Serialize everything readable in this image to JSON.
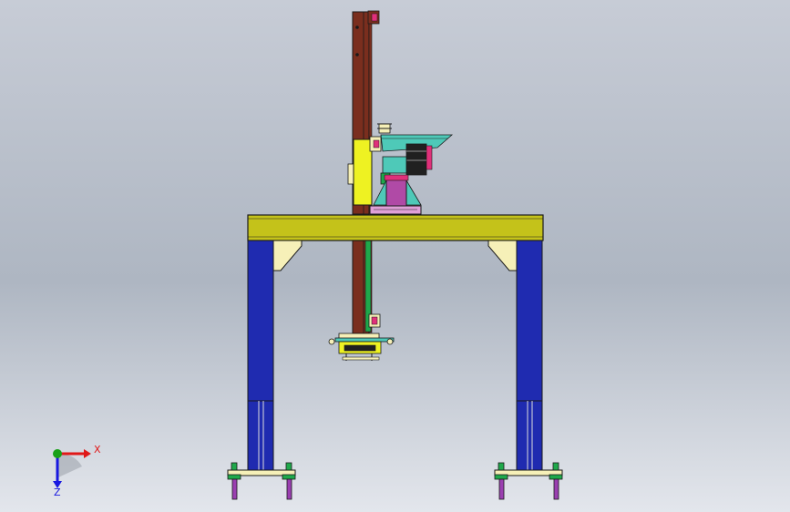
{
  "viewport": {
    "background_top": "#c7ccd6",
    "background_mid": "#aeb6c2",
    "background_bottom": "#e3e6ec"
  },
  "colors": {
    "outline": "#1a1a1a",
    "beam": "#c4c21a",
    "column": "#1f2bb0",
    "mast": "#7a2e1e",
    "bracket": "#f6f0b8",
    "carriage": "#eef222",
    "base_plate": "#e0a0d8",
    "motor_bracket": "#b04aa6",
    "teal_part": "#4ec9b8",
    "foot_green": "#1fa84b",
    "foot_stem": "#9a3fb0",
    "x_axis": "#e01818",
    "y_axis": "#18a018",
    "z_axis": "#1818e0"
  },
  "triad": {
    "x_label": "X",
    "z_label": "Z",
    "x_icon": "x-axis-arrow-icon",
    "y_icon": "y-axis-arrow-icon",
    "z_icon": "z-axis-arrow-icon"
  }
}
